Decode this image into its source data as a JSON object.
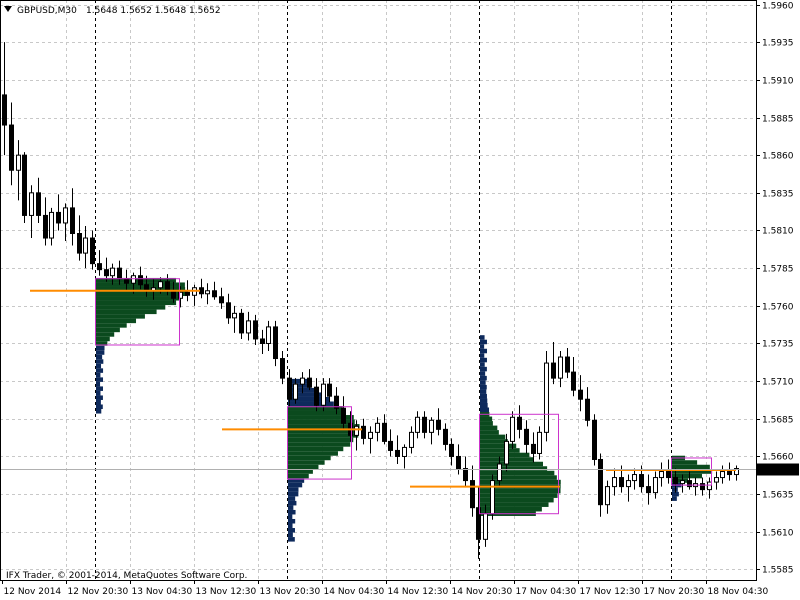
{
  "header": {
    "symbol_timeframe": "GBPUSD,M30",
    "ohlc": "1.5648 1.5652 1.5648 1.5652"
  },
  "footer": {
    "copyright": "IFX Trader, © 2001-2014, MetaQuotes Software Corp."
  },
  "colors": {
    "background": "#ffffff",
    "grid": "#c8c8c8",
    "candle": "#000000",
    "profile_primary": "#0b4a1e",
    "profile_secondary": "#0e2a5c",
    "value_area_box": "#cc33cc",
    "poc_line": "#ff8c00",
    "current_price_line": "#b0b0b0"
  },
  "price_axis": {
    "labels": [
      "1.5960",
      "1.5935",
      "1.5910",
      "1.5885",
      "1.5860",
      "1.5835",
      "1.5810",
      "1.5785",
      "1.5760",
      "1.5735",
      "1.5710",
      "1.5685",
      "1.5660",
      "1.5635",
      "1.5610",
      "1.5585"
    ],
    "current_price": "1.5652"
  },
  "time_axis": {
    "labels": [
      "12 Nov 2014",
      "12 Nov 20:30",
      "13 Nov 04:30",
      "13 Nov 12:30",
      "13 Nov 20:30",
      "14 Nov 04:30",
      "14 Nov 12:30",
      "14 Nov 20:30",
      "17 Nov 04:30",
      "17 Nov 12:30",
      "17 Nov 20:30",
      "18 Nov 04:30"
    ]
  },
  "chart_data": {
    "type": "candlestick",
    "symbol": "GBPUSD",
    "timeframe": "M30",
    "ylim": [
      1.5578,
      1.5963
    ],
    "candles": [
      [
        1.59,
        1.5935,
        1.586,
        1.588
      ],
      [
        1.588,
        1.5895,
        1.584,
        1.585
      ],
      [
        1.585,
        1.587,
        1.583,
        1.586
      ],
      [
        1.586,
        1.5862,
        1.5815,
        1.582
      ],
      [
        1.582,
        1.584,
        1.5805,
        1.5835
      ],
      [
        1.5835,
        1.5845,
        1.5815,
        1.582
      ],
      [
        1.582,
        1.5832,
        1.58,
        1.5805
      ],
      [
        1.5805,
        1.5825,
        1.58,
        1.5822
      ],
      [
        1.5822,
        1.5834,
        1.581,
        1.5815
      ],
      [
        1.5815,
        1.5828,
        1.5803,
        1.5825
      ],
      [
        1.5825,
        1.5838,
        1.58,
        1.5808
      ],
      [
        1.5808,
        1.582,
        1.579,
        1.5795
      ],
      [
        1.5795,
        1.5813,
        1.5785,
        1.5805
      ],
      [
        1.5805,
        1.581,
        1.5784,
        1.5788
      ],
      [
        1.5788,
        1.5797,
        1.578,
        1.5784
      ],
      [
        1.5784,
        1.5792,
        1.5776,
        1.578
      ],
      [
        1.578,
        1.5788,
        1.5774,
        1.5785
      ],
      [
        1.5785,
        1.579,
        1.5774,
        1.5778
      ],
      [
        1.5778,
        1.5784,
        1.577,
        1.5775
      ],
      [
        1.5775,
        1.5782,
        1.5768,
        1.578
      ],
      [
        1.578,
        1.5786,
        1.5771,
        1.5774
      ],
      [
        1.5774,
        1.578,
        1.5766,
        1.577
      ],
      [
        1.577,
        1.5778,
        1.5764,
        1.5772
      ],
      [
        1.5772,
        1.5779,
        1.5768,
        1.5776
      ],
      [
        1.5776,
        1.5781,
        1.5767,
        1.577
      ],
      [
        1.577,
        1.5776,
        1.5762,
        1.5765
      ],
      [
        1.5765,
        1.5773,
        1.5759,
        1.5769
      ],
      [
        1.5769,
        1.5777,
        1.5763,
        1.5767
      ],
      [
        1.5767,
        1.5774,
        1.576,
        1.5772
      ],
      [
        1.5772,
        1.5778,
        1.5765,
        1.5768
      ],
      [
        1.5768,
        1.5775,
        1.5761,
        1.577
      ],
      [
        1.577,
        1.5776,
        1.5764,
        1.5766
      ],
      [
        1.5766,
        1.5772,
        1.5758,
        1.5762
      ],
      [
        1.5762,
        1.5768,
        1.5748,
        1.5752
      ],
      [
        1.5752,
        1.576,
        1.5742,
        1.5755
      ],
      [
        1.5755,
        1.5758,
        1.5738,
        1.5742
      ],
      [
        1.5742,
        1.5756,
        1.5737,
        1.575
      ],
      [
        1.575,
        1.5754,
        1.5734,
        1.5738
      ],
      [
        1.5738,
        1.5744,
        1.5728,
        1.5735
      ],
      [
        1.5735,
        1.575,
        1.573,
        1.5746
      ],
      [
        1.5746,
        1.575,
        1.572,
        1.5725
      ],
      [
        1.5725,
        1.573,
        1.5708,
        1.5712
      ],
      [
        1.5712,
        1.5718,
        1.5693,
        1.5698
      ],
      [
        1.5698,
        1.5712,
        1.5695,
        1.5708
      ],
      [
        1.5708,
        1.5716,
        1.5702,
        1.5712
      ],
      [
        1.5712,
        1.5718,
        1.5704,
        1.5706
      ],
      [
        1.5706,
        1.5712,
        1.569,
        1.5694
      ],
      [
        1.5694,
        1.5712,
        1.569,
        1.5708
      ],
      [
        1.5708,
        1.5712,
        1.5696,
        1.57
      ],
      [
        1.57,
        1.5706,
        1.5688,
        1.5692
      ],
      [
        1.5692,
        1.57,
        1.5678,
        1.5682
      ],
      [
        1.5682,
        1.569,
        1.567,
        1.5674
      ],
      [
        1.5674,
        1.5684,
        1.5664,
        1.568
      ],
      [
        1.568,
        1.5685,
        1.5668,
        1.5672
      ],
      [
        1.5672,
        1.568,
        1.5662,
        1.5676
      ],
      [
        1.5676,
        1.5686,
        1.567,
        1.5682
      ],
      [
        1.5682,
        1.5688,
        1.5668,
        1.567
      ],
      [
        1.567,
        1.5678,
        1.566,
        1.5664
      ],
      [
        1.5664,
        1.5674,
        1.5655,
        1.566
      ],
      [
        1.566,
        1.5668,
        1.5652,
        1.5666
      ],
      [
        1.5666,
        1.568,
        1.5662,
        1.5676
      ],
      [
        1.5676,
        1.569,
        1.5672,
        1.5686
      ],
      [
        1.5686,
        1.569,
        1.5672,
        1.5676
      ],
      [
        1.5676,
        1.5686,
        1.5668,
        1.5684
      ],
      [
        1.5684,
        1.5692,
        1.5674,
        1.5678
      ],
      [
        1.5678,
        1.5682,
        1.5664,
        1.5668
      ],
      [
        1.5668,
        1.5672,
        1.5654,
        1.566
      ],
      [
        1.566,
        1.5668,
        1.5648,
        1.5652
      ],
      [
        1.5652,
        1.566,
        1.564,
        1.5644
      ],
      [
        1.5644,
        1.5654,
        1.562,
        1.5626
      ],
      [
        1.5626,
        1.564,
        1.5592,
        1.5605
      ],
      [
        1.5605,
        1.5628,
        1.56,
        1.5622
      ],
      [
        1.5622,
        1.5648,
        1.5618,
        1.5644
      ],
      [
        1.5644,
        1.566,
        1.564,
        1.5655
      ],
      [
        1.5655,
        1.5675,
        1.565,
        1.567
      ],
      [
        1.567,
        1.569,
        1.5665,
        1.5686
      ],
      [
        1.5686,
        1.5694,
        1.5672,
        1.5678
      ],
      [
        1.5678,
        1.5684,
        1.5662,
        1.5668
      ],
      [
        1.5668,
        1.5676,
        1.5656,
        1.5662
      ],
      [
        1.5662,
        1.568,
        1.5658,
        1.5676
      ],
      [
        1.5676,
        1.573,
        1.567,
        1.5722
      ],
      [
        1.5722,
        1.5736,
        1.5708,
        1.5712
      ],
      [
        1.5712,
        1.573,
        1.5706,
        1.5726
      ],
      [
        1.5726,
        1.5732,
        1.5712,
        1.5716
      ],
      [
        1.5716,
        1.5726,
        1.57,
        1.5704
      ],
      [
        1.5704,
        1.5714,
        1.569,
        1.5698
      ],
      [
        1.5698,
        1.5706,
        1.568,
        1.5684
      ],
      [
        1.5684,
        1.5688,
        1.5654,
        1.5658
      ],
      [
        1.5658,
        1.5662,
        1.562,
        1.5628
      ],
      [
        1.5628,
        1.5644,
        1.5622,
        1.564
      ],
      [
        1.564,
        1.5652,
        1.5634,
        1.5646
      ],
      [
        1.5646,
        1.5654,
        1.5636,
        1.564
      ],
      [
        1.564,
        1.5648,
        1.563,
        1.5644
      ],
      [
        1.5644,
        1.5652,
        1.5638,
        1.5648
      ],
      [
        1.5648,
        1.5654,
        1.5636,
        1.564
      ],
      [
        1.564,
        1.5648,
        1.5628,
        1.5636
      ],
      [
        1.5636,
        1.565,
        1.5632,
        1.5646
      ],
      [
        1.5646,
        1.5656,
        1.564,
        1.565
      ],
      [
        1.565,
        1.5658,
        1.5642,
        1.5646
      ],
      [
        1.5646,
        1.5652,
        1.5636,
        1.5642
      ],
      [
        1.5642,
        1.5648,
        1.5636,
        1.5644
      ],
      [
        1.5644,
        1.565,
        1.5638,
        1.564
      ],
      [
        1.564,
        1.5646,
        1.5634,
        1.5642
      ],
      [
        1.5642,
        1.5646,
        1.5634,
        1.5638
      ],
      [
        1.5638,
        1.5646,
        1.5632,
        1.5643
      ],
      [
        1.5643,
        1.565,
        1.5638,
        1.5646
      ],
      [
        1.5646,
        1.5654,
        1.5642,
        1.565
      ],
      [
        1.565,
        1.5656,
        1.5644,
        1.5648
      ],
      [
        1.5648,
        1.5654,
        1.5644,
        1.5652
      ]
    ],
    "sessions": [
      {
        "name": "12 Nov",
        "poc": 1.577,
        "value_area": [
          1.5734,
          1.5778
        ],
        "profile_range": [
          1.569,
          1.5778
        ]
      },
      {
        "name": "13 Nov",
        "poc": 1.5678,
        "value_area": [
          1.5645,
          1.5693
        ],
        "profile_range": [
          1.5605,
          1.5712
        ]
      },
      {
        "name": "14 Nov",
        "poc": 1.564,
        "value_area": [
          1.5622,
          1.5688
        ],
        "profile_range": [
          1.5622,
          1.574
        ]
      },
      {
        "name": "17 Nov",
        "poc": 1.5651,
        "value_area": [
          1.5641,
          1.5659
        ],
        "profile_range": [
          1.5632,
          1.5659
        ]
      }
    ],
    "grid": true
  }
}
